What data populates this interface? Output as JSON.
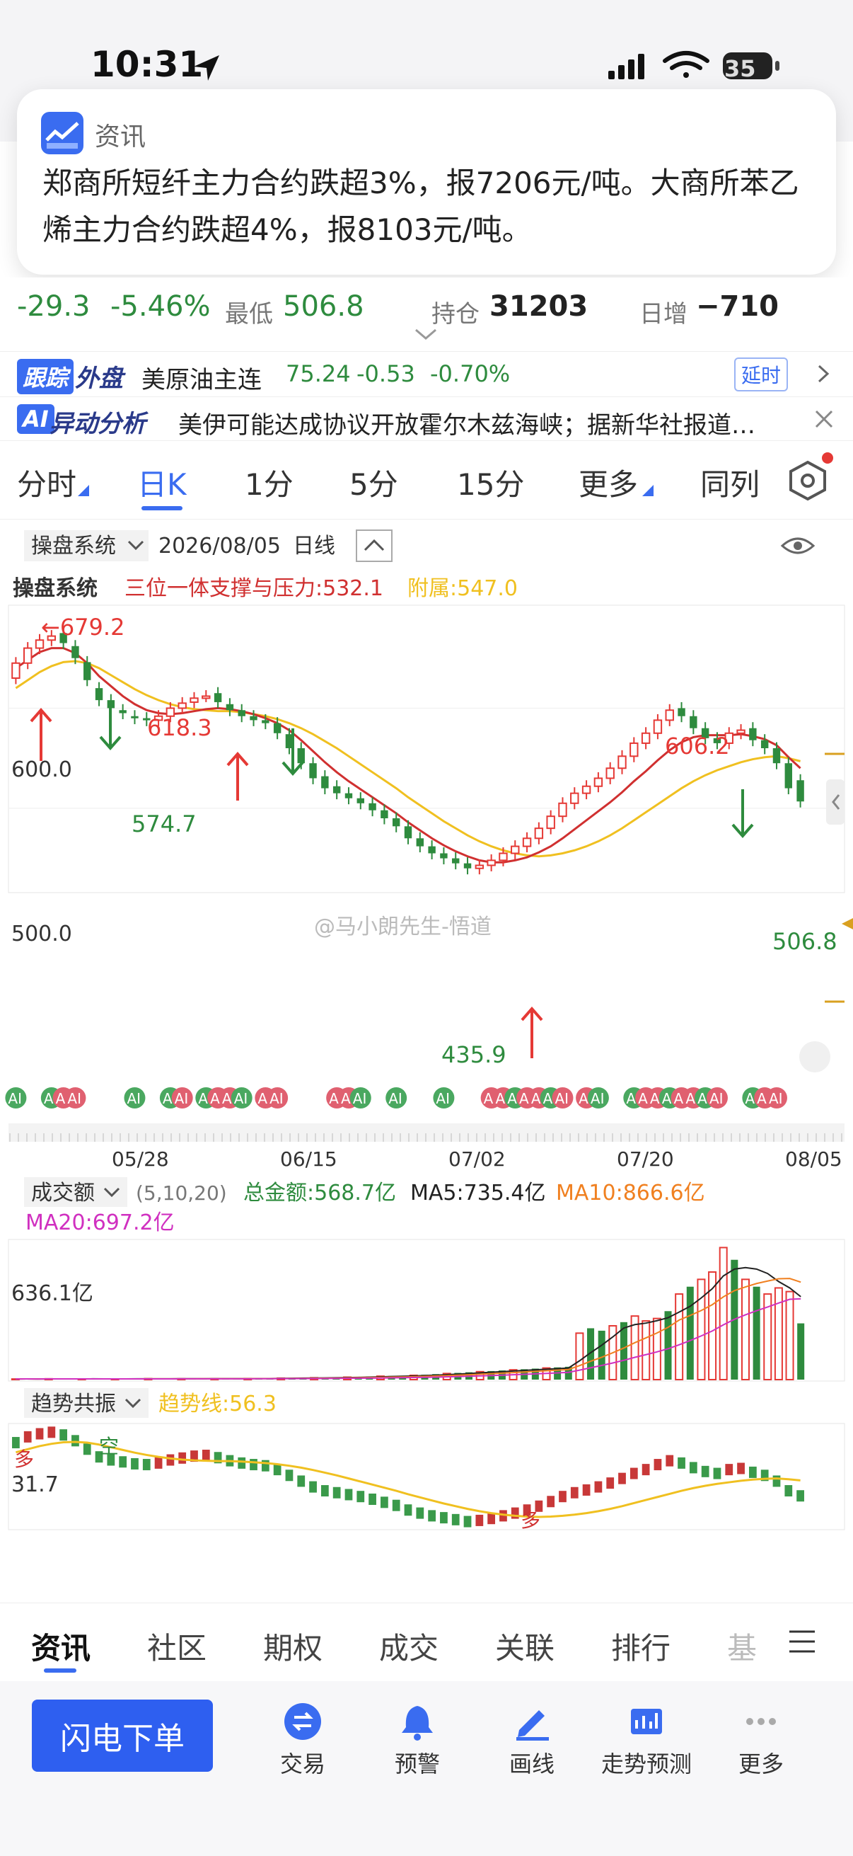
{
  "status_bar": {
    "time": "10:31",
    "battery": "35"
  },
  "notification": {
    "app_name": "资讯",
    "message": "郑商所短纤主力合约跌超3%，报7206元/吨。大商所苯乙烯主力合约跌超4%，报8103元/吨。"
  },
  "quote": {
    "change": "-29.3",
    "change_pct": "-5.46%",
    "low_label": "最低",
    "low_value": "506.8",
    "oi_label": "持仓",
    "oi_value": "31203",
    "daily_inc_label": "日增",
    "daily_inc_value": "−710"
  },
  "foreign_row": {
    "badge": "跟踪",
    "tag": "外盘",
    "name": "美原油主连",
    "price": "75.24",
    "change": "-0.53",
    "change_pct": "-0.70%",
    "delay_label": "延时"
  },
  "ai_row": {
    "badge": "AI",
    "title": "异动分析",
    "text": "美伊可能达成协议开放霍尔木兹海峡；据新华社报道…"
  },
  "period_tabs": [
    "分时",
    "日K",
    "1分",
    "5分",
    "15分",
    "更多",
    "同列"
  ],
  "chart_header": {
    "system_select": "操盘系统",
    "date": "2026/08/05",
    "period": "日线",
    "title": "操盘系统",
    "support_label": "三位一体支撑与压力:532.1",
    "attach_label": "附属:547.0"
  },
  "price_chart": {
    "y_labels": [
      "600.0",
      "500.0"
    ],
    "annotations": [
      "←679.2",
      "618.3",
      "574.7",
      "435.9",
      "606.2",
      "506.8"
    ],
    "watermark": "@马小朗先生-悟道",
    "x_labels": [
      "05/28",
      "06/15",
      "07/02",
      "07/20",
      "08/05"
    ],
    "ai_marker": "AI"
  },
  "volume_panel": {
    "select": "成交额",
    "params": "(5,10,20)",
    "total": "总金额:568.7亿",
    "ma5": "MA5:735.4亿",
    "ma10": "MA10:866.6亿",
    "ma20": "MA20:697.2亿",
    "y_label": "636.1亿"
  },
  "trend_panel": {
    "select": "趋势共振",
    "line_label": "趋势线:56.3",
    "y_label": "31.7",
    "marks": [
      "多",
      "空",
      "多"
    ]
  },
  "bottom_tabs": [
    "资讯",
    "社区",
    "期权",
    "成交",
    "关联",
    "排行",
    "基"
  ],
  "dock": {
    "order_button": "闪电下单",
    "items": [
      "交易",
      "预警",
      "画线",
      "走势预测",
      "更多"
    ]
  },
  "colors": {
    "up": "#e53935",
    "down": "#2e8b3e",
    "accent": "#3a6cf0",
    "ma_yellow": "#f0c020",
    "ma_red": "#d03030"
  },
  "chart_data": [
    {
      "type": "candlestick",
      "title": "操盘系统",
      "x_labels": [
        "05/28",
        "06/15",
        "07/02",
        "07/20",
        "08/05"
      ],
      "ylim": [
        420,
        700
      ],
      "y_ticks": [
        600.0,
        500.0
      ],
      "annotated_points": {
        "high": 679.2,
        "low": 435.9,
        "local_high_1": 618.3,
        "local_low_1": 574.7,
        "local_high_2": 606.2,
        "last": 506.8
      },
      "close_series": [
        645,
        660,
        668,
        672,
        665,
        650,
        628,
        608,
        600,
        595,
        590,
        588,
        592,
        600,
        605,
        610,
        612,
        606,
        598,
        592,
        588,
        585,
        575,
        560,
        545,
        530,
        520,
        515,
        510,
        505,
        498,
        490,
        482,
        470,
        462,
        455,
        450,
        445,
        440,
        443,
        448,
        455,
        462,
        470,
        480,
        492,
        505,
        515,
        522,
        530,
        540,
        552,
        565,
        575,
        588,
        598,
        592,
        580,
        570,
        565,
        575,
        578,
        568,
        560,
        545,
        520,
        506.8
      ],
      "open_series": [
        630,
        645,
        660,
        668,
        675,
        662,
        646,
        620,
        608,
        598,
        592,
        590,
        588,
        592,
        600,
        606,
        612,
        615,
        604,
        598,
        592,
        588,
        585,
        574,
        560,
        545,
        532,
        522,
        515,
        510,
        505,
        498,
        490,
        482,
        470,
        462,
        455,
        450,
        445,
        440,
        443,
        448,
        455,
        462,
        470,
        480,
        492,
        505,
        515,
        522,
        530,
        540,
        552,
        565,
        575,
        588,
        600,
        592,
        580,
        570,
        565,
        575,
        580,
        568,
        560,
        545,
        528
      ],
      "ma_short": [
        640,
        648,
        656,
        660,
        660,
        655,
        645,
        632,
        622,
        612,
        604,
        598,
        595,
        594,
        595,
        597,
        599,
        600,
        599,
        597,
        594,
        590,
        585,
        578,
        568,
        557,
        546,
        536,
        527,
        519,
        511,
        503,
        495,
        486,
        478,
        470,
        463,
        457,
        452,
        448,
        446,
        446,
        448,
        451,
        456,
        462,
        470,
        479,
        488,
        497,
        506,
        516,
        527,
        537,
        548,
        558,
        566,
        571,
        573,
        573,
        573,
        574,
        572,
        569,
        563,
        551,
        540
      ],
      "ma_long": [
        620,
        628,
        636,
        642,
        646,
        647,
        645,
        640,
        633,
        626,
        619,
        613,
        608,
        604,
        601,
        599,
        598,
        597,
        597,
        596,
        594,
        592,
        589,
        585,
        580,
        574,
        567,
        560,
        552,
        544,
        536,
        528,
        520,
        511,
        503,
        495,
        487,
        480,
        473,
        467,
        462,
        458,
        455,
        453,
        452,
        453,
        455,
        458,
        462,
        467,
        473,
        480,
        488,
        496,
        504,
        512,
        520,
        527,
        533,
        538,
        542,
        546,
        549,
        551,
        552,
        550,
        547
      ]
    },
    {
      "type": "bar",
      "title": "成交额",
      "ylim": [
        0,
        1100
      ],
      "y_ticks": [
        636.1
      ],
      "values": [
        5,
        6,
        5,
        7,
        6,
        5,
        6,
        7,
        6,
        5,
        6,
        7,
        8,
        7,
        6,
        7,
        8,
        9,
        8,
        7,
        8,
        9,
        10,
        11,
        12,
        13,
        14,
        15,
        16,
        18,
        20,
        22,
        25,
        28,
        30,
        32,
        35,
        40,
        45,
        50,
        55,
        60,
        65,
        70,
        75,
        80,
        85,
        90,
        95,
        100,
        105,
        380,
        420,
        400,
        440,
        470,
        520,
        480,
        500,
        560,
        700,
        760,
        820,
        880,
        1080,
        980,
        820,
        760,
        700,
        750,
        720,
        460
      ],
      "ma5_last": 735.4,
      "ma10_last": 866.6,
      "ma20_last": 697.2
    },
    {
      "type": "bar",
      "title": "趋势共振",
      "ylim": [
        0,
        100
      ],
      "y_ticks": [
        31.7
      ],
      "line_last": 56.3
    }
  ]
}
